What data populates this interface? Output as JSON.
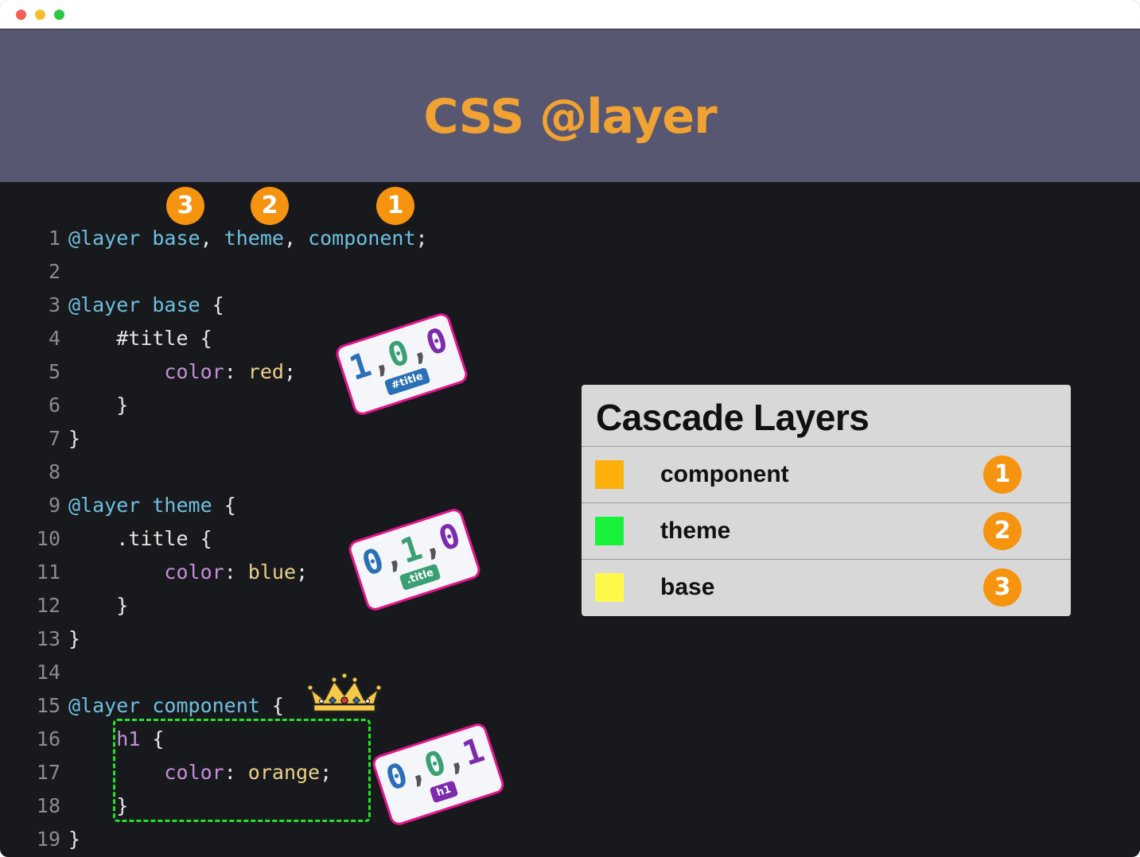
{
  "window": {
    "controls": [
      "close",
      "minimize",
      "maximize"
    ],
    "colors": {
      "close": "#f25f56",
      "minimize": "#f5bd2f",
      "maximize": "#2ec843"
    }
  },
  "banner": {
    "title": "CSS @layer",
    "background": "#575772",
    "title_color": "#f0a233"
  },
  "code": {
    "lines": [
      {
        "n": "1",
        "tokens": [
          [
            "kw",
            "@layer"
          ],
          [
            "pn",
            " "
          ],
          [
            "nm",
            "base"
          ],
          [
            "pn",
            ", "
          ],
          [
            "nm",
            "theme"
          ],
          [
            "pn",
            ", "
          ],
          [
            "nm",
            "component"
          ],
          [
            "pn",
            ";"
          ]
        ]
      },
      {
        "n": "2",
        "tokens": []
      },
      {
        "n": "3",
        "tokens": [
          [
            "kw",
            "@layer"
          ],
          [
            "pn",
            " "
          ],
          [
            "nm",
            "base"
          ],
          [
            "pn",
            " {"
          ]
        ]
      },
      {
        "n": "4",
        "tokens": [
          [
            "pn",
            "    "
          ],
          [
            "sel",
            "#title"
          ],
          [
            "pn",
            " {"
          ]
        ]
      },
      {
        "n": "5",
        "tokens": [
          [
            "pn",
            "        "
          ],
          [
            "prop",
            "color"
          ],
          [
            "pn",
            ": "
          ],
          [
            "val",
            "red"
          ],
          [
            "pn",
            ";"
          ]
        ]
      },
      {
        "n": "6",
        "tokens": [
          [
            "pn",
            "    }"
          ]
        ]
      },
      {
        "n": "7",
        "tokens": [
          [
            "pn",
            "}"
          ]
        ]
      },
      {
        "n": "8",
        "tokens": []
      },
      {
        "n": "9",
        "tokens": [
          [
            "kw",
            "@layer"
          ],
          [
            "pn",
            " "
          ],
          [
            "nm",
            "theme"
          ],
          [
            "pn",
            " {"
          ]
        ]
      },
      {
        "n": "10",
        "tokens": [
          [
            "pn",
            "    "
          ],
          [
            "sel",
            ".title"
          ],
          [
            "pn",
            " {"
          ]
        ]
      },
      {
        "n": "11",
        "tokens": [
          [
            "pn",
            "        "
          ],
          [
            "prop",
            "color"
          ],
          [
            "pn",
            ": "
          ],
          [
            "val",
            "blue"
          ],
          [
            "pn",
            ";"
          ]
        ]
      },
      {
        "n": "12",
        "tokens": [
          [
            "pn",
            "    }"
          ]
        ]
      },
      {
        "n": "13",
        "tokens": [
          [
            "pn",
            "}"
          ]
        ]
      },
      {
        "n": "14",
        "tokens": []
      },
      {
        "n": "15",
        "tokens": [
          [
            "kw",
            "@layer"
          ],
          [
            "pn",
            " "
          ],
          [
            "nm",
            "component"
          ],
          [
            "pn",
            " {"
          ]
        ]
      },
      {
        "n": "16",
        "tokens": [
          [
            "pn",
            "    "
          ],
          [
            "tag",
            "h1"
          ],
          [
            "pn",
            " {"
          ]
        ]
      },
      {
        "n": "17",
        "tokens": [
          [
            "pn",
            "        "
          ],
          [
            "prop",
            "color"
          ],
          [
            "pn",
            ": "
          ],
          [
            "val",
            "orange"
          ],
          [
            "pn",
            ";"
          ]
        ]
      },
      {
        "n": "18",
        "tokens": [
          [
            "pn",
            "    }"
          ]
        ]
      },
      {
        "n": "19",
        "tokens": [
          [
            "pn",
            "}"
          ]
        ]
      }
    ],
    "order_badges": [
      "3",
      "2",
      "1"
    ]
  },
  "specificity_cards": [
    {
      "a": "1",
      "b": "0",
      "c": "0",
      "chip": "#title",
      "chip_color": "#2a70b6"
    },
    {
      "a": "0",
      "b": "1",
      "c": "0",
      "chip": ".title",
      "chip_color": "#3aa073"
    },
    {
      "a": "0",
      "b": "0",
      "c": "1",
      "chip": "h1",
      "chip_color": "#7b2bab"
    }
  ],
  "highlight": {
    "icon": "crown-icon"
  },
  "legend": {
    "title": "Cascade Layers",
    "rows": [
      {
        "label": "component",
        "rank": "1",
        "color": "#fdb00b"
      },
      {
        "label": "theme",
        "rank": "2",
        "color": "#18f23a"
      },
      {
        "label": "base",
        "rank": "3",
        "color": "#fdf84a"
      }
    ]
  }
}
